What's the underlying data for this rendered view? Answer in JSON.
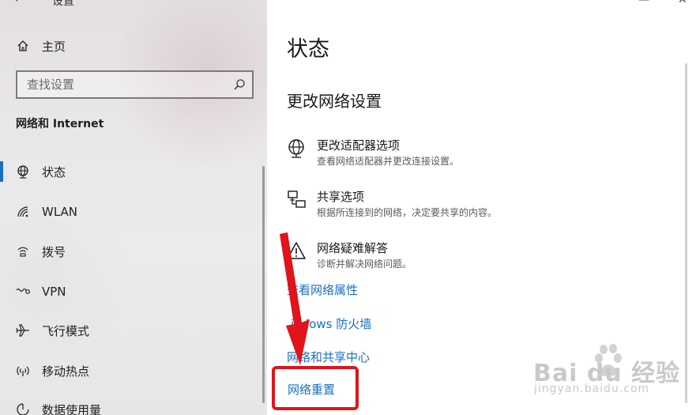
{
  "window": {
    "title": "设置",
    "back_label": "←",
    "minimize_label": "—",
    "close_label": "✕"
  },
  "sidebar": {
    "home_label": "主页",
    "search_placeholder": "查找设置",
    "section_title": "网络和 Internet",
    "items": [
      {
        "label": "状态",
        "icon": "globe-icon"
      },
      {
        "label": "WLAN",
        "icon": "wifi-icon"
      },
      {
        "label": "拨号",
        "icon": "dialup-icon"
      },
      {
        "label": "VPN",
        "icon": "vpn-icon"
      },
      {
        "label": "飞行模式",
        "icon": "airplane-icon"
      },
      {
        "label": "移动热点",
        "icon": "hotspot-icon"
      },
      {
        "label": "数据使用量",
        "icon": "data-usage-icon"
      }
    ]
  },
  "main": {
    "title": "状态",
    "subtitle": "更改网络设置",
    "options": [
      {
        "title": "更改适配器选项",
        "desc": "查看网络适配器并更改连接设置。",
        "icon": "adapter-icon"
      },
      {
        "title": "共享选项",
        "desc": "根据所连接到的网络，决定要共享的内容。",
        "icon": "sharing-icon"
      },
      {
        "title": "网络疑难解答",
        "desc": "诊断并解决网络问题。",
        "icon": "warning-icon"
      }
    ],
    "links": [
      {
        "label": "查看网络属性"
      },
      {
        "label": "indows 防火墙"
      },
      {
        "label": "网络和共享中心"
      },
      {
        "label": "网络重置"
      }
    ]
  },
  "watermark": {
    "brand": "Bai du 经验",
    "url": "jingyan.baidu.com"
  },
  "colors": {
    "accent": "#1670c2",
    "highlight": "#e0141a"
  }
}
